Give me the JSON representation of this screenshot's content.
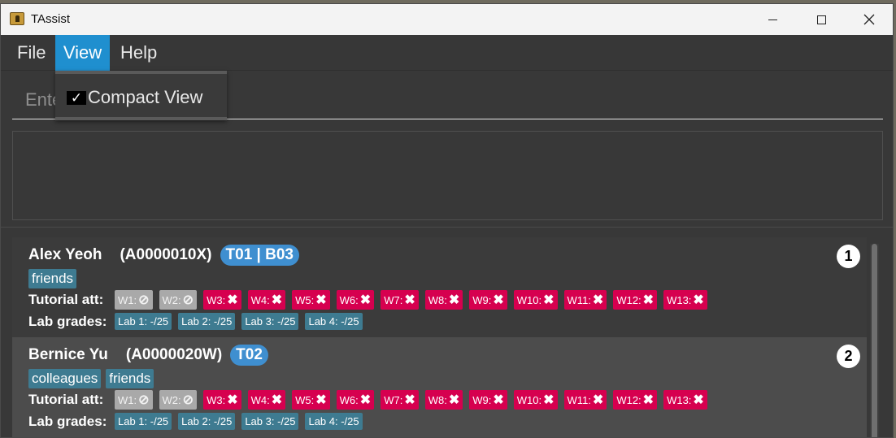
{
  "window": {
    "title": "TAssist"
  },
  "menubar": {
    "file": "File",
    "view": "View",
    "help": "Help"
  },
  "view_menu": {
    "compact_view": "Compact View",
    "checkmark": "✓"
  },
  "command": {
    "placeholder": "Enter command here..."
  },
  "labels": {
    "tutorial": "Tutorial att:",
    "lab": "Lab grades:"
  },
  "persons": [
    {
      "index": "1",
      "name": "Alex Yeoh",
      "id": "(A0000010X)",
      "group": "T01 | B03",
      "tags": [
        "friends"
      ],
      "attendance": [
        {
          "week": "W1:",
          "status": "na"
        },
        {
          "week": "W2:",
          "status": "na"
        },
        {
          "week": "W3:",
          "status": "absent"
        },
        {
          "week": "W4:",
          "status": "absent"
        },
        {
          "week": "W5:",
          "status": "absent"
        },
        {
          "week": "W6:",
          "status": "absent"
        },
        {
          "week": "W7:",
          "status": "absent"
        },
        {
          "week": "W8:",
          "status": "absent"
        },
        {
          "week": "W9:",
          "status": "absent"
        },
        {
          "week": "W10:",
          "status": "absent"
        },
        {
          "week": "W11:",
          "status": "absent"
        },
        {
          "week": "W12:",
          "status": "absent"
        },
        {
          "week": "W13:",
          "status": "absent"
        }
      ],
      "labs": [
        "Lab 1: -/25",
        "Lab 2: -/25",
        "Lab 3: -/25",
        "Lab 4: -/25"
      ]
    },
    {
      "index": "2",
      "name": "Bernice Yu",
      "id": "(A0000020W)",
      "group": "T02",
      "tags": [
        "colleagues",
        "friends"
      ],
      "attendance": [
        {
          "week": "W1:",
          "status": "na"
        },
        {
          "week": "W2:",
          "status": "na"
        },
        {
          "week": "W3:",
          "status": "absent"
        },
        {
          "week": "W4:",
          "status": "absent"
        },
        {
          "week": "W5:",
          "status": "absent"
        },
        {
          "week": "W6:",
          "status": "absent"
        },
        {
          "week": "W7:",
          "status": "absent"
        },
        {
          "week": "W8:",
          "status": "absent"
        },
        {
          "week": "W9:",
          "status": "absent"
        },
        {
          "week": "W10:",
          "status": "absent"
        },
        {
          "week": "W11:",
          "status": "absent"
        },
        {
          "week": "W12:",
          "status": "absent"
        },
        {
          "week": "W13:",
          "status": "absent"
        }
      ],
      "labs": [
        "Lab 1: -/25",
        "Lab 2: -/25",
        "Lab 3: -/25",
        "Lab 4: -/25"
      ]
    }
  ],
  "glyphs": {
    "na": "⊘",
    "absent": "✖"
  },
  "colors": {
    "accent": "#1f8fcf",
    "absent": "#d6004f",
    "na": "#a9a9a9",
    "tag": "#3e7b91",
    "group": "#3f8fd0"
  }
}
